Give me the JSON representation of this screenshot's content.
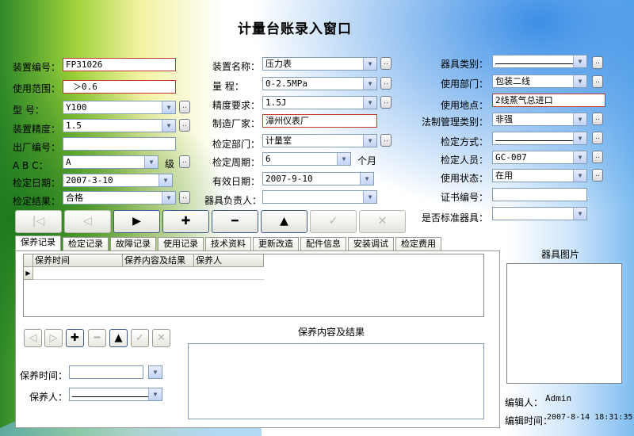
{
  "window": {
    "title": "计量台账录入窗口"
  },
  "colors": {
    "accent": "#3b5b8c",
    "required_border": "#c0392b"
  },
  "left": {
    "device_no": {
      "label": "装置编号：",
      "value": "FP31026"
    },
    "use_range": {
      "label": "使用范围：",
      "value": "＞0.6"
    },
    "model": {
      "label": "型    号：",
      "value": "Y100"
    },
    "precision": {
      "label": "装置精度：",
      "value": "1.5"
    },
    "factory_no": {
      "label": "出厂编号：",
      "value": ""
    },
    "abc": {
      "label": "A  B  C：",
      "value": "A",
      "suffix": "级"
    },
    "check_date": {
      "label": "检定日期：",
      "value": "2007-3-10"
    },
    "check_result": {
      "label": "检定结果：",
      "value": "合格"
    }
  },
  "middle": {
    "device_name": {
      "label": "装置名称：",
      "value": "压力表"
    },
    "range": {
      "label": "量    程：",
      "value": "0-2.5MPa"
    },
    "accuracy": {
      "label": "精度要求：",
      "value": "1.5J"
    },
    "manufacturer": {
      "label": "制造厂家：",
      "value": "漳州仪表厂"
    },
    "check_dept": {
      "label": "检定部门：",
      "value": "计量室"
    },
    "check_period": {
      "label": "检定周期：",
      "value": "6",
      "suffix": "个月"
    },
    "valid_date": {
      "label": "有效日期：",
      "value": "2007-9-10"
    },
    "owner": {
      "label": "器具负责人：",
      "value": ""
    }
  },
  "right": {
    "category": {
      "label": "器具类别：",
      "value": ""
    },
    "use_dept": {
      "label": "使用部门：",
      "value": "包装二线"
    },
    "location": {
      "label": "使用地点：",
      "value": "2线蒸气总进口"
    },
    "legal_category": {
      "label": "法制管理类别：",
      "value": "非强"
    },
    "check_method": {
      "label": "检定方式：",
      "value": ""
    },
    "inspector": {
      "label": "检定人员：",
      "value": "GC-007"
    },
    "status": {
      "label": "使用状态：",
      "value": "在用"
    },
    "cert_no": {
      "label": "证书编号：",
      "value": ""
    },
    "standard": {
      "label": "是否标准器具：",
      "value": ""
    }
  },
  "nav_buttons": [
    {
      "symbol": "|◁",
      "enabled": false
    },
    {
      "symbol": "◁",
      "enabled": false
    },
    {
      "symbol": "▶",
      "enabled": true
    },
    {
      "symbol": "✚",
      "enabled": true
    },
    {
      "symbol": "━",
      "enabled": true
    },
    {
      "symbol": "▲",
      "enabled": true
    },
    {
      "symbol": "✓",
      "enabled": false
    },
    {
      "symbol": "✕",
      "enabled": false
    }
  ],
  "tabs": [
    "保养记录",
    "检定记录",
    "故障记录",
    "使用记录",
    "技术资料",
    "更新改造",
    "配件信息",
    "安装调试",
    "检定费用"
  ],
  "grid": {
    "columns": [
      "保养时间",
      "保养内容及结果",
      "保养人"
    ]
  },
  "sub_buttons": [
    {
      "symbol": "◁",
      "enabled": false
    },
    {
      "symbol": "▷",
      "enabled": false
    },
    {
      "symbol": "✚",
      "enabled": true
    },
    {
      "symbol": "━",
      "enabled": false
    },
    {
      "symbol": "▲",
      "enabled": true
    },
    {
      "symbol": "✓",
      "enabled": false
    },
    {
      "symbol": "✕",
      "enabled": false
    }
  ],
  "maintenance": {
    "content_label": "保养内容及结果",
    "time_label": "保养时间：",
    "person_label": "保养人："
  },
  "photo": {
    "label": "器具图片"
  },
  "editor": {
    "label": "编辑人：",
    "value": "Admin"
  },
  "edit_time": {
    "label": "编辑时间：",
    "value": "2007-8-14 18:31:35"
  }
}
